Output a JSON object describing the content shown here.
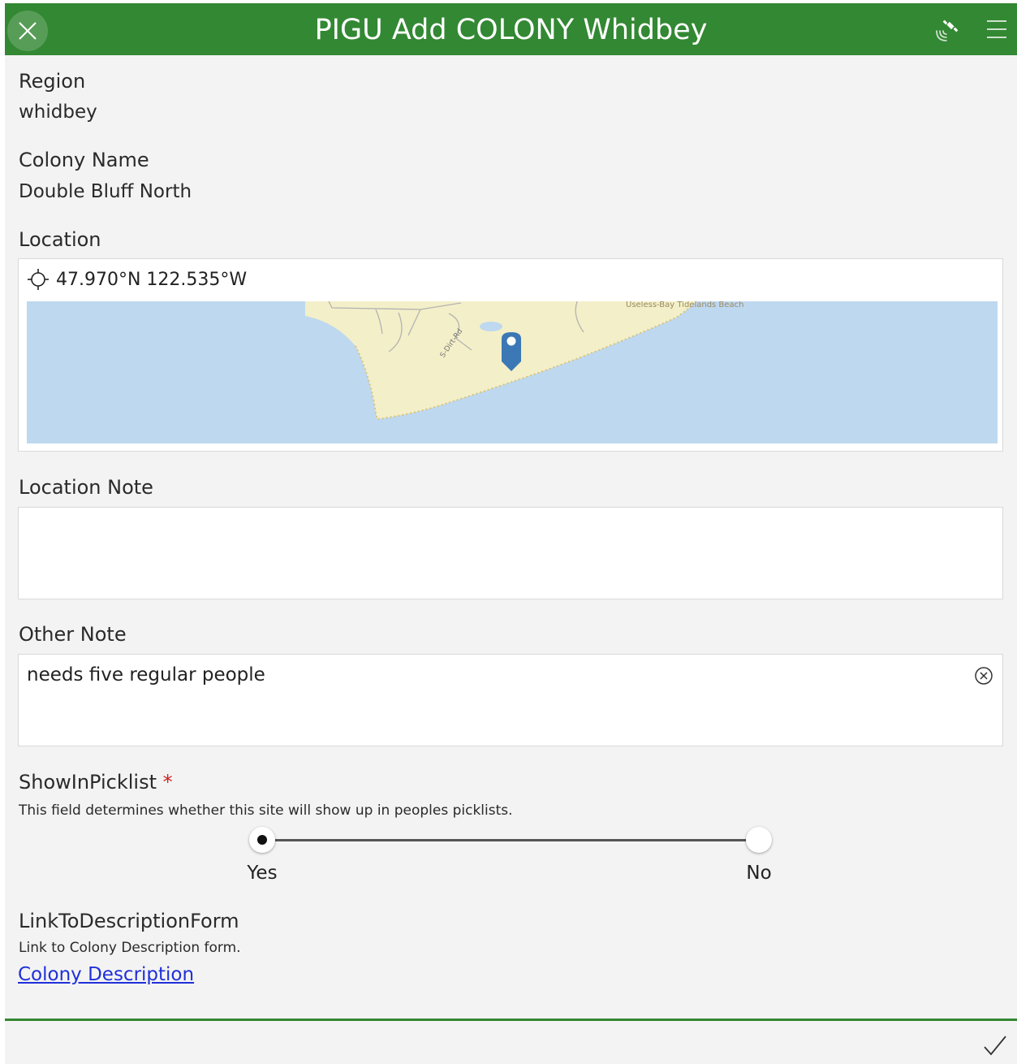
{
  "header": {
    "title": "PIGU Add COLONY Whidbey",
    "color": "#338833",
    "close_icon": "close-icon",
    "gps_icon": "gps-satellite-icon",
    "menu_icon": "hamburger-menu-icon"
  },
  "form": {
    "region": {
      "label": "Region",
      "value": "whidbey"
    },
    "colony_name": {
      "label": "Colony Name",
      "value": "Double Bluff North"
    },
    "location": {
      "label": "Location",
      "coordinates": "47.970°N 122.535°W",
      "map_labels": {
        "road": "S-Dirt-Rd",
        "place": "Useless-Bay Tidelands Beach"
      }
    },
    "location_note": {
      "label": "Location Note",
      "value": ""
    },
    "other_note": {
      "label": "Other Note",
      "value": "needs five regular people"
    },
    "show_in_picklist": {
      "label": "ShowInPicklist",
      "required_mark": "*",
      "hint": "This field determines whether this site will show up in peoples picklists.",
      "options": [
        "Yes",
        "No"
      ],
      "selected": "Yes"
    },
    "link_to_description": {
      "label": "LinkToDescriptionForm",
      "hint": "Link to Colony Description form.",
      "link_text": "Colony Description"
    }
  },
  "footer": {
    "submit_icon": "checkmark-icon"
  }
}
